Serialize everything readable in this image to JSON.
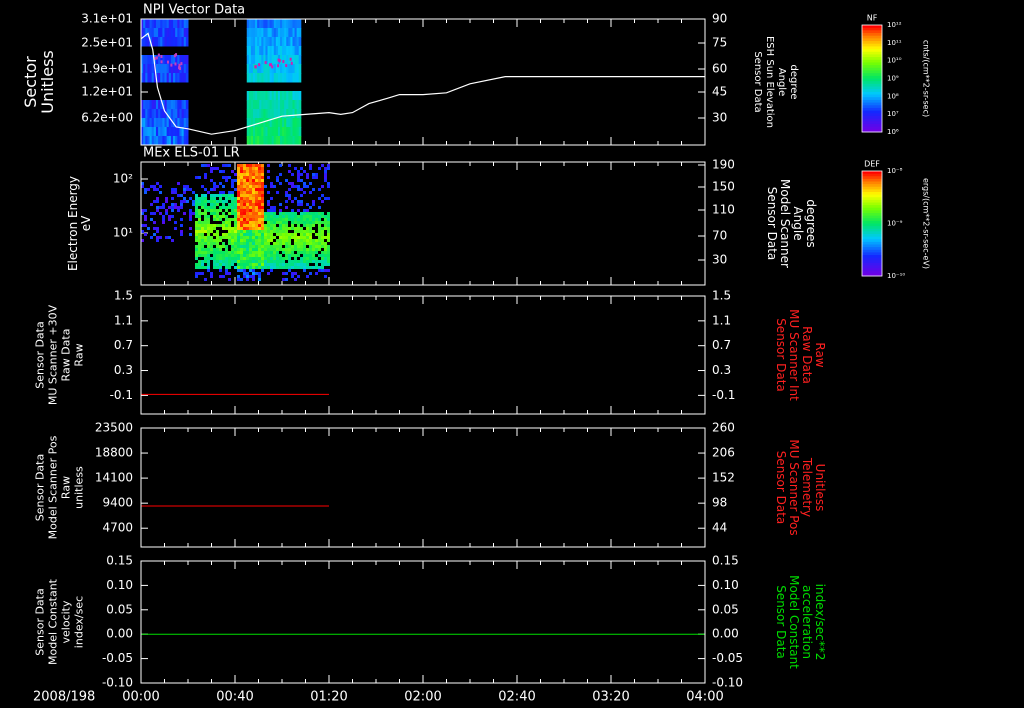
{
  "date_label": "2008/198",
  "time_ticks": [
    "00:00",
    "00:40",
    "01:20",
    "02:00",
    "02:40",
    "03:20",
    "04:00"
  ],
  "colorbars": [
    {
      "title": "NF",
      "units": "cnts/(cm**2-sr-sec)",
      "labels": [
        "10¹²",
        "10¹¹",
        "10¹⁰",
        "10⁹",
        "10⁸",
        "10⁷",
        "10⁶"
      ]
    },
    {
      "title": "DEF",
      "units": "ergs/(cm**2-sr-sec-eV)",
      "labels": [
        "10⁻⁸",
        "10⁻⁹",
        "10⁻¹⁰"
      ]
    }
  ],
  "chart_data": [
    {
      "type": "heatmap",
      "title": "NPI Vector Data",
      "ylabel": [
        "Sector",
        "Unitless"
      ],
      "yticks": [
        "3.1e+01",
        "2.5e+01",
        "1.9e+01",
        "1.2e+01",
        "6.2e+00"
      ],
      "y2label": [
        "Sensor Data",
        "ESH Sun Elevation",
        "Angle",
        "degree"
      ],
      "y2ticks": [
        "90",
        "75",
        "60",
        "45",
        "30"
      ],
      "y2lim": [
        20,
        90
      ],
      "overlay_line": {
        "color": "#ffffff",
        "x_minutes": [
          0,
          3,
          5,
          7,
          10,
          15,
          20,
          30,
          40,
          50,
          55,
          60,
          70,
          80,
          85,
          90,
          97,
          105,
          110,
          120,
          130,
          140,
          155,
          180,
          210,
          240
        ],
        "y_degrees": [
          79,
          82,
          73,
          52,
          39,
          30,
          29,
          26,
          28,
          32,
          34,
          36,
          37,
          38,
          37,
          38,
          43,
          46,
          48,
          48,
          49,
          54,
          58,
          58,
          58,
          58
        ]
      }
    },
    {
      "type": "heatmap",
      "title": "MEx ELS-01 LR",
      "ylabel": [
        "Electron Energy",
        "eV"
      ],
      "yticks": [
        "10²",
        "10¹"
      ],
      "y2label": [
        "Sensor Data",
        "Model Scanner",
        "Angle",
        "degrees"
      ],
      "y2ticks": [
        "190",
        "150",
        "110",
        "70",
        "30"
      ],
      "y2lim": [
        10,
        190
      ],
      "overlay_line": {
        "color": "#ffffff",
        "x_minutes": [
          0,
          240
        ],
        "y_degrees": [
          10,
          10
        ]
      }
    },
    {
      "type": "line",
      "ylabel": [
        "Sensor Data",
        "MU Scanner +30V",
        "Raw Data",
        "Raw"
      ],
      "yticks": [
        "1.5",
        "1.1",
        "0.7",
        "0.3",
        "-0.1"
      ],
      "ylim": [
        -0.3,
        1.5
      ],
      "y2label": [
        "Sensor Data",
        "MU Scanner Int",
        "Raw Data",
        "Raw"
      ],
      "y2ticks": [
        "1.5",
        "1.1",
        "0.7",
        "0.3",
        "-0.1"
      ],
      "series": [
        {
          "color": "#ff0000",
          "x_minutes": [
            0,
            80
          ],
          "values": [
            0.0,
            0.0
          ]
        }
      ]
    },
    {
      "type": "line",
      "ylabel": [
        "Sensor Data",
        "Model Scanner Pos",
        "Raw",
        "unitless"
      ],
      "yticks": [
        "23500",
        "18800",
        "14100",
        "9400",
        "4700"
      ],
      "ylim": [
        0,
        23500
      ],
      "y2label": [
        "Sensor Data",
        "MU Scanner Pos",
        "Telemetry",
        "Unitless"
      ],
      "y2ticks": [
        "260",
        "206",
        "152",
        "98",
        "44"
      ],
      "series": [
        {
          "color": "#ff0000",
          "x_minutes": [
            0,
            80
          ],
          "values": [
            8100,
            8100
          ]
        }
      ]
    },
    {
      "type": "line",
      "ylabel": [
        "Sensor Data",
        "Model Constant",
        "velocity",
        "index/sec"
      ],
      "yticks": [
        "0.15",
        "0.10",
        "0.05",
        "0.00",
        "-0.05",
        "-0.10"
      ],
      "ylim": [
        -0.1,
        0.15
      ],
      "y2label": [
        "Sensor Data",
        "Model Constant",
        "acceleration",
        "index/sec**2"
      ],
      "y2ticks": [
        "0.15",
        "0.10",
        "0.05",
        "0.00",
        "-0.05",
        "-0.10"
      ],
      "series": [
        {
          "color": "#00dd00",
          "x_minutes": [
            0,
            240
          ],
          "values": [
            0.0,
            0.0
          ]
        }
      ]
    }
  ]
}
